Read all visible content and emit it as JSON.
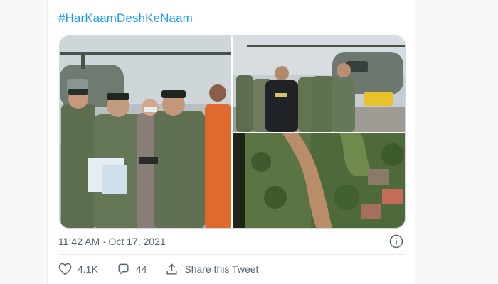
{
  "tweet": {
    "hashtag": "#HarKaamDeshKeNaam",
    "timestamp": "11:42 AM · Oct 17, 2021"
  },
  "actions": {
    "likes": "4.1K",
    "replies": "44",
    "share_label": "Share this Tweet"
  },
  "colors": {
    "link": "#1d9bf0",
    "muted": "#536471",
    "border": "#cfd9de"
  }
}
